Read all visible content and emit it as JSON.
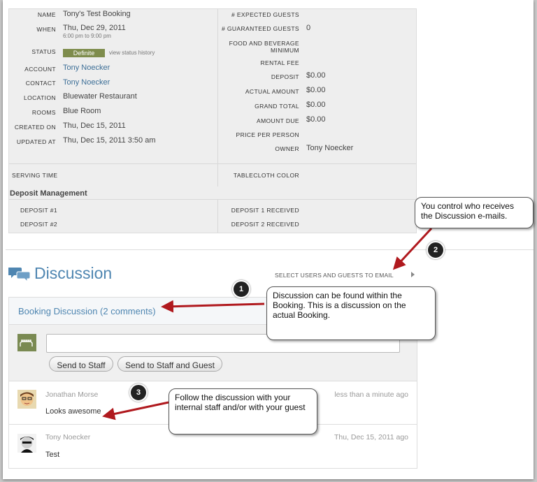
{
  "details": {
    "left": [
      {
        "label": "NAME",
        "value": "Tony's Test Booking"
      },
      {
        "label": "WHEN",
        "value": "Thu, Dec 29, 2011",
        "sub": "6:00 pm to 9:00 pm"
      },
      {
        "label": "STATUS",
        "badge": "Definite",
        "link": "view status history"
      },
      {
        "label": "ACCOUNT",
        "value": "Tony Noecker"
      },
      {
        "label": "CONTACT",
        "value": "Tony Noecker"
      },
      {
        "label": "LOCATION",
        "value": "Bluewater Restaurant"
      },
      {
        "label": "ROOMS",
        "value": "Blue Room"
      },
      {
        "label": "CREATED ON",
        "value": "Thu, Dec 15, 2011"
      },
      {
        "label": "UPDATED AT",
        "value": "Thu, Dec 15, 2011 3:50 am"
      }
    ],
    "right": [
      {
        "label": "# EXPECTED GUESTS",
        "value": ""
      },
      {
        "label": "# GUARANTEED GUESTS",
        "value": "0"
      },
      {
        "label": "FOOD AND BEVERAGE MINIMUM",
        "value": ""
      },
      {
        "label": "RENTAL FEE",
        "value": ""
      },
      {
        "label": "DEPOSIT",
        "value": "$0.00"
      },
      {
        "label": "ACTUAL AMOUNT",
        "value": "$0.00"
      },
      {
        "label": "GRAND TOTAL",
        "value": "$0.00"
      },
      {
        "label": "AMOUNT DUE",
        "value": "$0.00"
      },
      {
        "label": "PRICE PER PERSON",
        "value": ""
      },
      {
        "label": "OWNER",
        "value": "Tony Noecker"
      }
    ],
    "serving_time_label": "SERVING TIME",
    "tablecloth_label": "TABLECLOTH COLOR",
    "deposit_title": "Deposit Management",
    "deposit1_label": "DEPOSIT #1",
    "deposit2_label": "DEPOSIT #2",
    "deposit1_received_label": "DEPOSIT 1 RECEIVED",
    "deposit2_received_label": "DEPOSIT 2 RECEIVED"
  },
  "discussion": {
    "title": "Discussion",
    "email_link": "SELECT USERS AND GUESTS TO EMAIL",
    "panel_title": "Booking Discussion (2 comments)",
    "send_staff": "Send to Staff",
    "send_staff_guest": "Send to Staff and Guest",
    "comments": [
      {
        "name": "Jonathan Morse",
        "time": "less than a minute ago",
        "text": "Looks awesome"
      },
      {
        "name": "Tony Noecker",
        "time": "Thu, Dec 15, 2011 ago",
        "text": "Test"
      }
    ]
  },
  "callouts": {
    "c1": {
      "num": "1",
      "text": "Discussion can be found within the Booking. This is a discussion on the actual Booking."
    },
    "c2": {
      "num": "2",
      "text": "You control who receives the Discussion e-mails."
    },
    "c3": {
      "num": "3",
      "text": "Follow the discussion with your internal staff and/or with your guest"
    }
  },
  "colors": {
    "accent": "#4f86b1",
    "status": "#7e8c4c",
    "arrow": "#b0191e"
  }
}
